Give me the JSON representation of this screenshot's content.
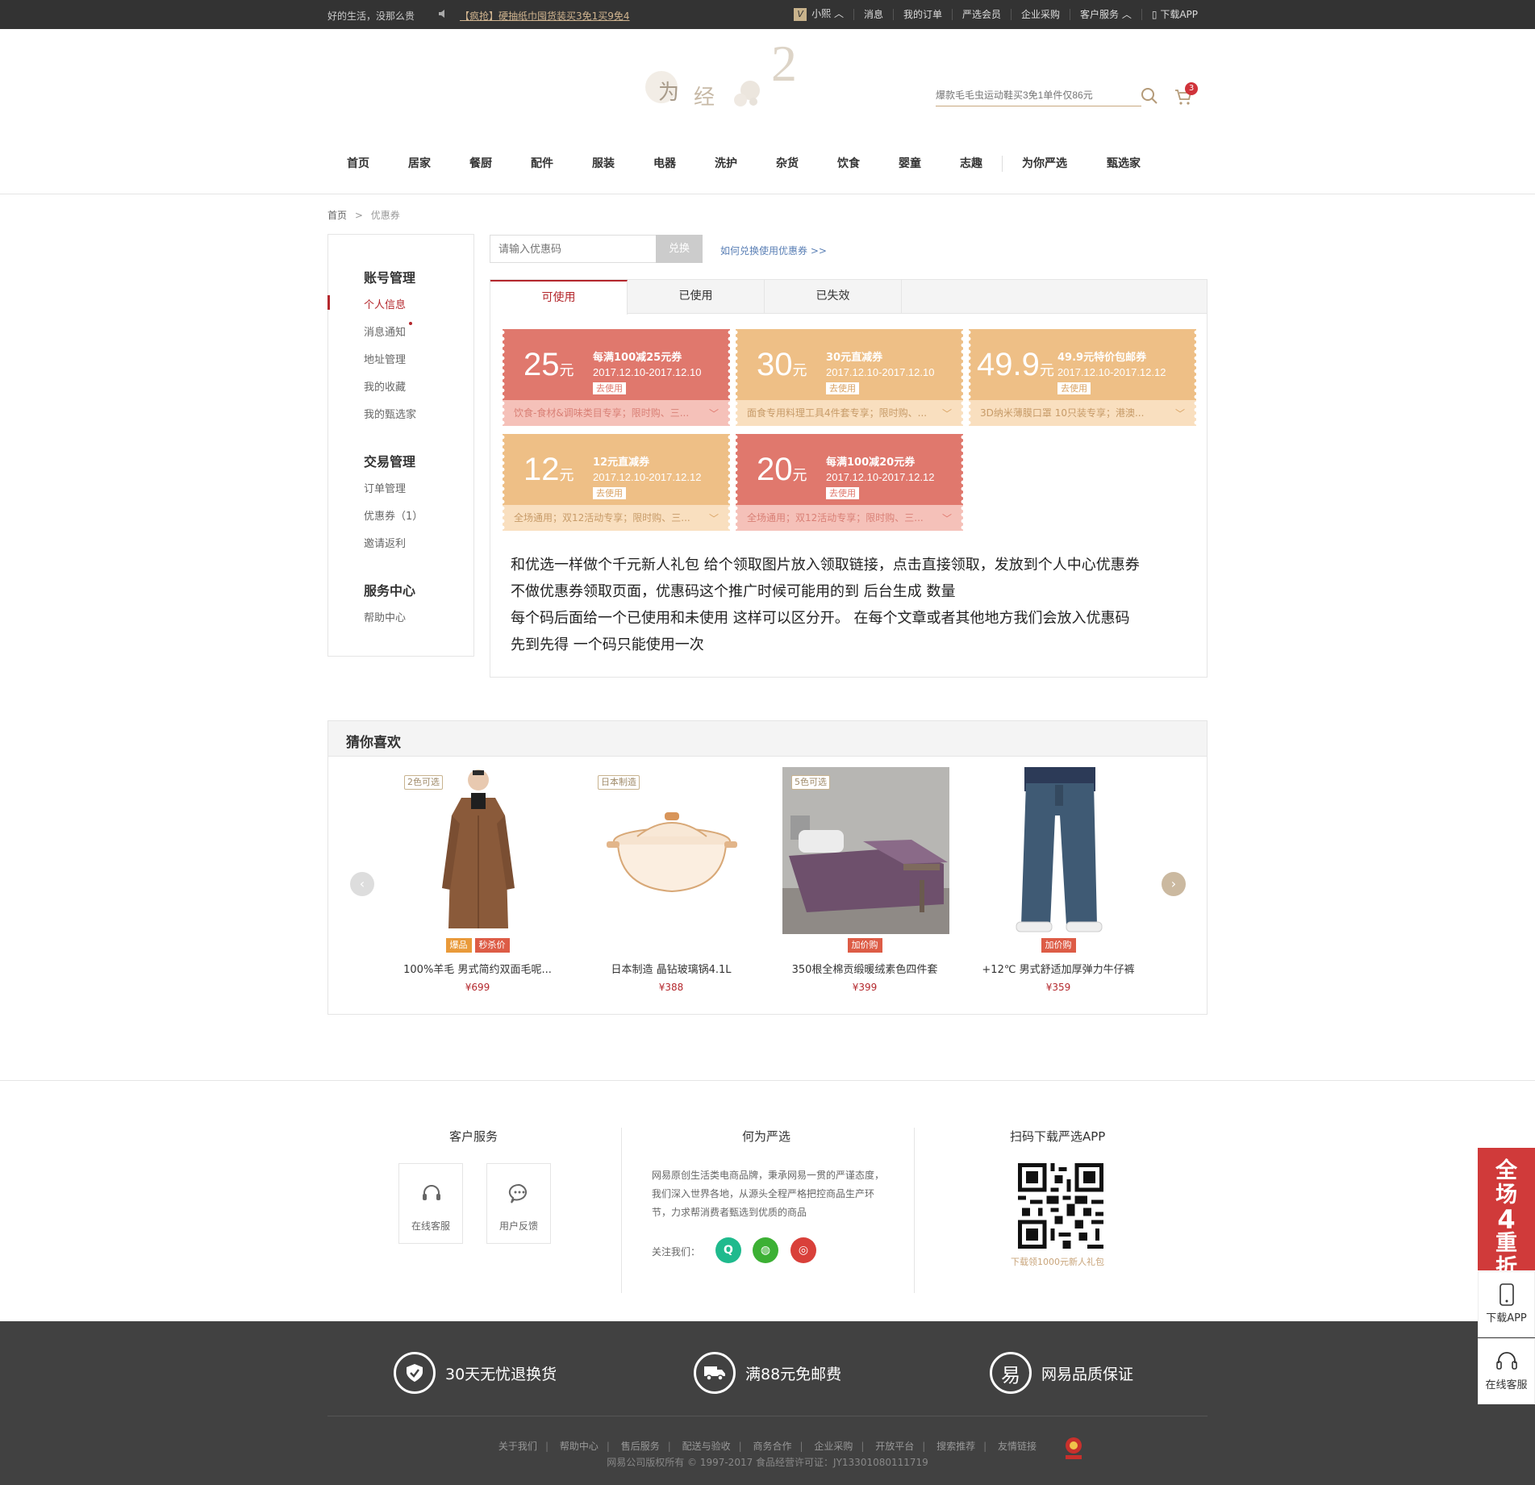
{
  "topbar": {
    "slogan": "好的生活，没那么贵",
    "promo": "【疯抢】硬抽纸巾囤货装买3免1买9免4",
    "user": "小熙",
    "links": [
      "消息",
      "我的订单",
      "严选会员",
      "企业采购",
      "客户服务",
      "下载APP"
    ]
  },
  "logo": {
    "char1": "为",
    "char2": "经",
    "num": "2"
  },
  "search": {
    "placeholder": "爆款毛毛虫运动鞋买3免1单件仅86元"
  },
  "cart": {
    "count": "3"
  },
  "nav": [
    "首页",
    "居家",
    "餐厨",
    "配件",
    "服装",
    "电器",
    "洗护",
    "杂货",
    "饮食",
    "婴童",
    "志趣",
    "为你严选",
    "甄选家"
  ],
  "breadcrumb": {
    "home": "首页",
    "sep": ">",
    "current": "优惠券"
  },
  "sidebar": {
    "account": {
      "title": "账号管理",
      "items": [
        "个人信息",
        "消息通知",
        "地址管理",
        "我的收藏",
        "我的甄选家"
      ]
    },
    "trade": {
      "title": "交易管理",
      "items": [
        "订单管理",
        "优惠券（1）",
        "邀请返利"
      ]
    },
    "service": {
      "title": "服务中心",
      "items": [
        "帮助中心"
      ]
    }
  },
  "redeem": {
    "placeholder": "请输入优惠码",
    "button": "兑换",
    "howto": "如何兑换使用优惠券 >>"
  },
  "tabs": [
    "可使用",
    "已使用",
    "已失效"
  ],
  "coupons": [
    {
      "amount": "25",
      "unit": "元",
      "name": "每满100减25元券",
      "date": "2017.12.10-2017.12.10",
      "use": "去使用",
      "desc": "饮食-食材&调味类目专享；限时购、三..."
    },
    {
      "amount": "30",
      "unit": "元",
      "name": "30元直减券",
      "date": "2017.12.10-2017.12.10",
      "use": "去使用",
      "desc": "面食专用料理工具4件套专享；限时购、..."
    },
    {
      "amount": "49.9",
      "unit": "元",
      "name": "49.9元特价包邮券",
      "date": "2017.12.10-2017.12.12",
      "use": "去使用",
      "desc": "3D纳米薄膜口罩 10只装专享；港澳..."
    },
    {
      "amount": "12",
      "unit": "元",
      "name": "12元直减券",
      "date": "2017.12.10-2017.12.12",
      "use": "去使用",
      "desc": "全场通用；双12活动专享；限时购、三..."
    },
    {
      "amount": "20",
      "unit": "元",
      "name": "每满100减20元券",
      "date": "2017.12.10-2017.12.12",
      "use": "去使用",
      "desc": "全场通用；双12活动专享；限时购、三..."
    }
  ],
  "notes": [
    "和优选一样做个千元新人礼包 给个领取图片放入领取链接，点击直接领取，发放到个人中心优惠券",
    "不做优惠券领取页面，优惠码这个推广时候可能用的到 后台生成 数量",
    "每个码后面给一个已使用和未使用 这样可以区分开。 在每个文章或者其他地方我们会放入优惠码",
    "先到先得 一个码只能使用一次"
  ],
  "guess": {
    "title": "猜你喜欢",
    "products": [
      {
        "tag": "2色可选",
        "badges": [
          "爆品",
          "秒杀价"
        ],
        "name": "100%羊毛 男式简约双面毛呢...",
        "price": "¥699"
      },
      {
        "tag": "日本制造",
        "badges": [],
        "name": "日本制造 晶钻玻璃锅4.1L",
        "price": "¥388"
      },
      {
        "tag": "5色可选",
        "badges": [
          "加价购"
        ],
        "name": "350根全棉贡缎暖绒素色四件套",
        "price": "¥399"
      },
      {
        "tag": "",
        "badges": [
          "加价购"
        ],
        "name": "+12℃ 男式舒适加厚弹力牛仔裤",
        "price": "¥359"
      }
    ]
  },
  "footer": {
    "service_title": "客户服务",
    "online": "在线客服",
    "feedback": "用户反馈",
    "about_title": "何为严选",
    "about_text": "网易原创生活类电商品牌，秉承网易一贯的严谨态度，我们深入世界各地，从源头全程严格把控商品生产环节，力求帮消费者甄选到优质的商品",
    "follow": "关注我们：",
    "app_title": "扫码下载严选APP",
    "app_sub": "下载领1000元新人礼包",
    "guarantees": [
      "30天无忧退换货",
      "满88元免邮费",
      "网易品质保证"
    ],
    "links": [
      "关于我们",
      "帮助中心",
      "售后服务",
      "配送与验收",
      "商务合作",
      "企业采购",
      "开放平台",
      "搜索推荐",
      "友情链接"
    ],
    "copyright": "网易公司版权所有 © 1997-2017   食品经营许可证：JY13301080111719"
  },
  "float": {
    "sale": [
      "全",
      "场",
      "4",
      "重",
      "折"
    ],
    "app": "下载APP",
    "service": "在线客服"
  },
  "colors": {
    "brand_red": "#b4282d",
    "coupon_red": "#e0786d",
    "coupon_orange": "#eebf86",
    "gold": "#c8a47a"
  }
}
